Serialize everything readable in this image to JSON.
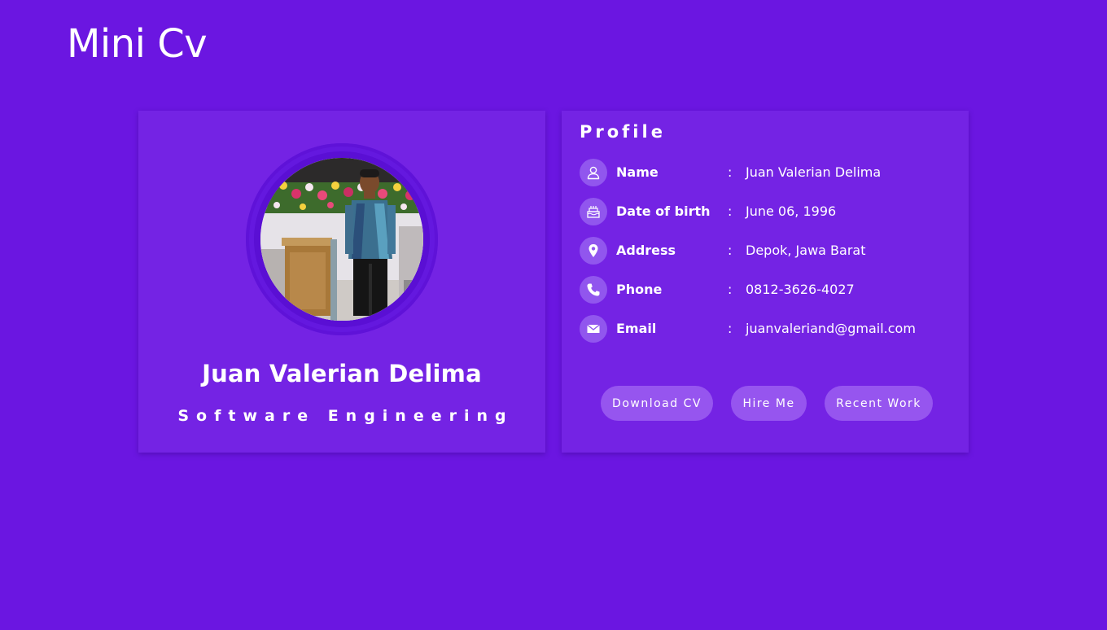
{
  "site": {
    "title": "Mini Cv"
  },
  "profile_card": {
    "name": "Juan Valerian Delima",
    "role": "Software Engineering"
  },
  "details": {
    "heading": "Profile",
    "separator": ":",
    "rows": [
      {
        "icon": "user-icon",
        "label": "Name",
        "value": "Juan Valerian Delima"
      },
      {
        "icon": "cake-icon",
        "label": "Date of birth",
        "value": "June 06, 1996"
      },
      {
        "icon": "location-pin-icon",
        "label": "Address",
        "value": "Depok, Jawa Barat"
      },
      {
        "icon": "phone-icon",
        "label": "Phone",
        "value": "0812-3626-4027"
      },
      {
        "icon": "mail-icon",
        "label": "Email",
        "value": "juanvaleriand@gmail.com"
      }
    ]
  },
  "actions": {
    "download": "Download CV",
    "hire": "Hire Me",
    "recent": "Recent Work"
  },
  "colors": {
    "background": "#6b16e1",
    "card": "#7423e4",
    "accent": "#9655ef",
    "text": "#ffffff"
  }
}
